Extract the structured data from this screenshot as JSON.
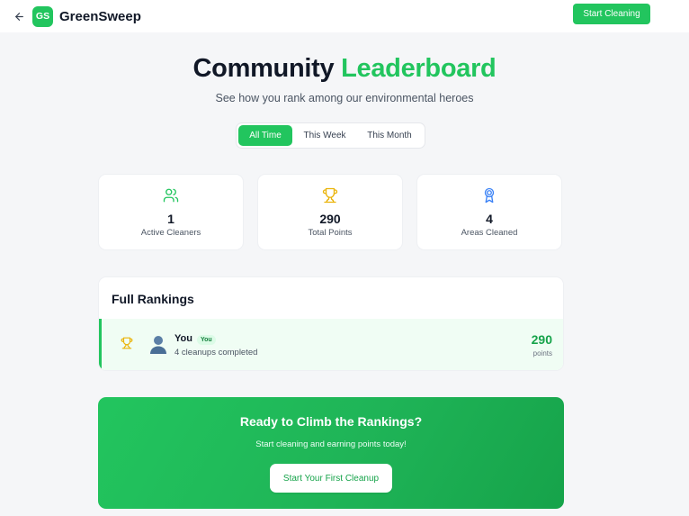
{
  "header": {
    "brand_initials": "GS",
    "brand_name": "GreenSweep",
    "start_button": "Start Cleaning"
  },
  "hero": {
    "title_part1": "Community",
    "title_part2": "Leaderboard",
    "subtitle": "See how you rank among our environmental heroes"
  },
  "tabs": [
    {
      "label": "All Time",
      "active": true
    },
    {
      "label": "This Week",
      "active": false
    },
    {
      "label": "This Month",
      "active": false
    }
  ],
  "stats": [
    {
      "icon": "users-icon",
      "value": "1",
      "label": "Active Cleaners",
      "color": "#22c55e"
    },
    {
      "icon": "trophy-icon",
      "value": "290",
      "label": "Total Points",
      "color": "#eab308"
    },
    {
      "icon": "award-icon",
      "value": "4",
      "label": "Areas Cleaned",
      "color": "#3b82f6"
    }
  ],
  "rankings": {
    "title": "Full Rankings",
    "rows": [
      {
        "rank_icon": "trophy-icon",
        "avatar_icon": "user-avatar-icon",
        "name": "You",
        "badge": "You",
        "subtitle": "4 cleanups completed",
        "points": "290",
        "points_label": "points"
      }
    ]
  },
  "cta": {
    "title": "Ready to Climb the Rankings?",
    "subtitle": "Start cleaning and earning points today!",
    "button": "Start Your First Cleanup"
  },
  "colors": {
    "accent": "#22c55e",
    "accent_dark": "#16a34a",
    "gold": "#eab308",
    "blue": "#3b82f6"
  }
}
